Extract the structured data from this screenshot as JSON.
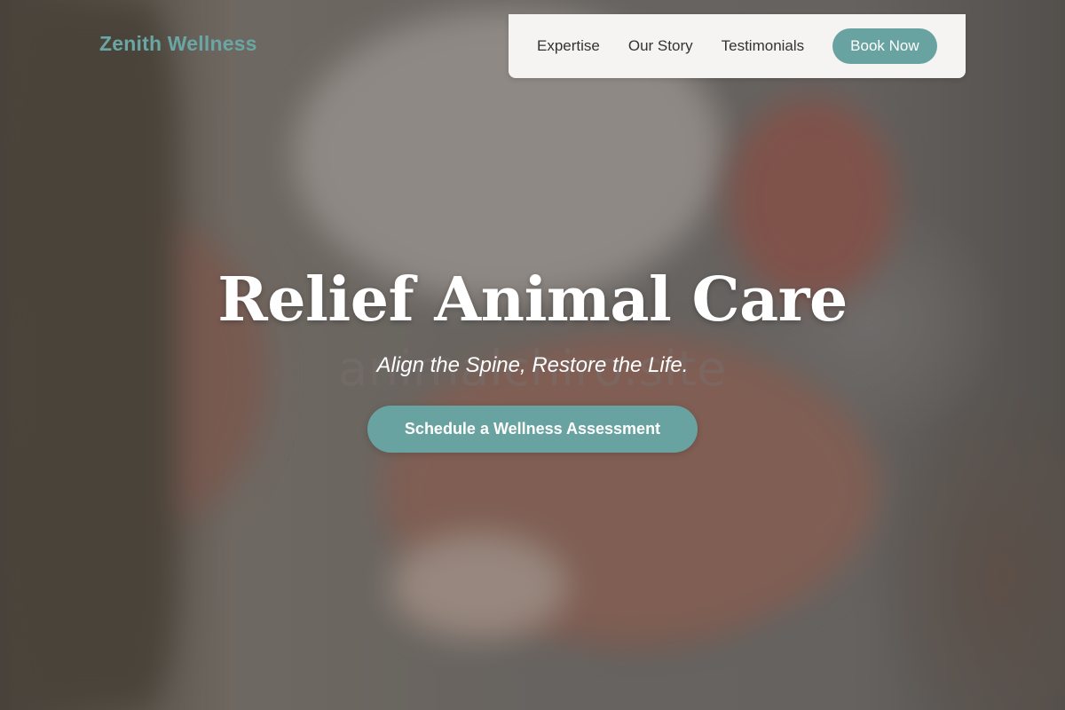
{
  "header": {
    "brand": "Zenith Wellness",
    "nav": {
      "items": [
        {
          "label": "Expertise"
        },
        {
          "label": "Our Story"
        },
        {
          "label": "Testimonials"
        }
      ],
      "book_label": "Book Now"
    }
  },
  "hero": {
    "title": "Relief Animal Care",
    "watermark": "animalchiro.site",
    "subtitle": "Align the Spine, Restore the Life.",
    "cta_label": "Schedule a Wellness Assessment"
  },
  "colors": {
    "accent": "#69a3a1",
    "nav_background": "#f5f4f3",
    "hero_text": "#ffffff"
  }
}
